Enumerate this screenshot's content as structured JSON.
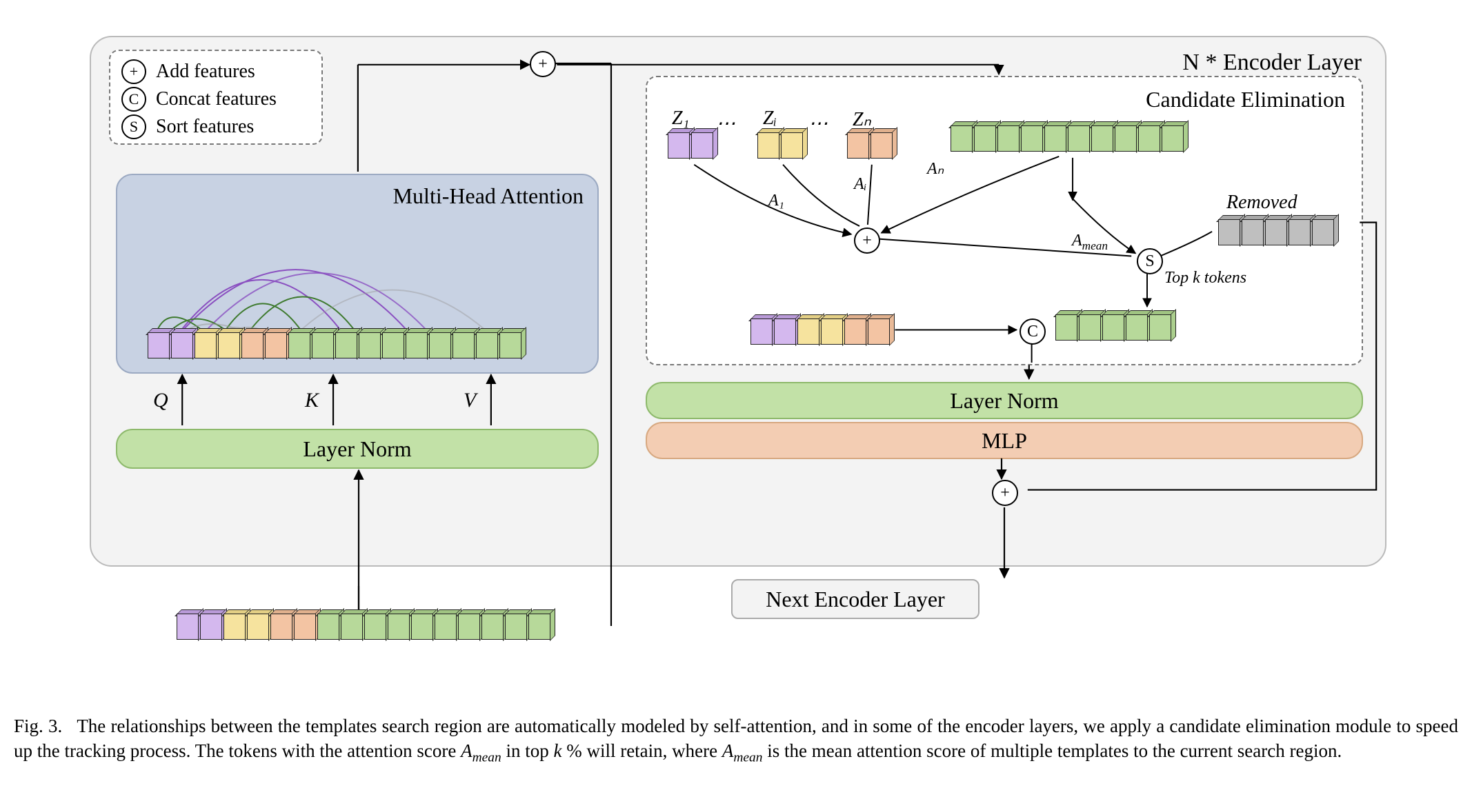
{
  "figure": {
    "number": "3",
    "label_prefix": "Fig.",
    "caption_part1": "The relationships between the templates search region are automatically modeled by self-attention, and in some of the encoder layers, we apply a candidate elimination module to speed up the tracking process. The tokens with the attention score ",
    "caption_Amean": "A",
    "caption_Amean_sub": "mean",
    "caption_part2": " in top ",
    "caption_k": "k",
    "caption_part3": "% will retain, where ",
    "caption_part4": " is the mean attention score of multiple templates to the current search region."
  },
  "encoder": {
    "title": "N * Encoder Layer",
    "mha_title": "Multi-Head Attention",
    "layer_norm": "Layer Norm",
    "mlp": "MLP",
    "next": "Next Encoder Layer",
    "qkv": {
      "Q": "Q",
      "K": "K",
      "V": "V"
    },
    "ce": {
      "title": "Candidate Elimination",
      "removed": "Removed",
      "topk": "Top k tokens",
      "Z1": "Z₁",
      "Zi": "Zᵢ",
      "Zn": "Zₙ",
      "A1": "A₁",
      "Ai": "Aᵢ",
      "An": "Aₙ",
      "Amean": "A",
      "Amean_sub": "mean",
      "dots": "⋯"
    }
  },
  "legend": {
    "add": "Add features",
    "concat": "Concat features",
    "sort": "Sort features",
    "plus": "+",
    "c": "C",
    "s": "S"
  },
  "op": {
    "plus": "+",
    "c": "C",
    "s": "S"
  },
  "token_sequences": {
    "full_row_colors": [
      "purple",
      "purple",
      "yellow",
      "yellow",
      "peach",
      "peach",
      "green",
      "green",
      "green",
      "green",
      "green",
      "green",
      "green",
      "green",
      "green",
      "green"
    ],
    "templates_row_colors": [
      "purple",
      "purple",
      "yellow",
      "yellow",
      "peach",
      "peach"
    ],
    "green10": [
      "green",
      "green",
      "green",
      "green",
      "green",
      "green",
      "green",
      "green",
      "green",
      "green"
    ],
    "green5": [
      "green",
      "green",
      "green",
      "green",
      "green"
    ],
    "grey5": [
      "grey",
      "grey",
      "grey",
      "grey",
      "grey"
    ],
    "z_pair": 2
  },
  "colors": {
    "purple": "#d4b8ee",
    "yellow": "#f6e39e",
    "peach": "#f3c4a3",
    "green": "#b7d99a",
    "grey": "#bfbfbf",
    "panel_bg": "#f3f3f3",
    "mha_bg": "#c8d2e3",
    "layernorm_bg": "#c2e1a7",
    "mlp_bg": "#f3cdb3"
  }
}
